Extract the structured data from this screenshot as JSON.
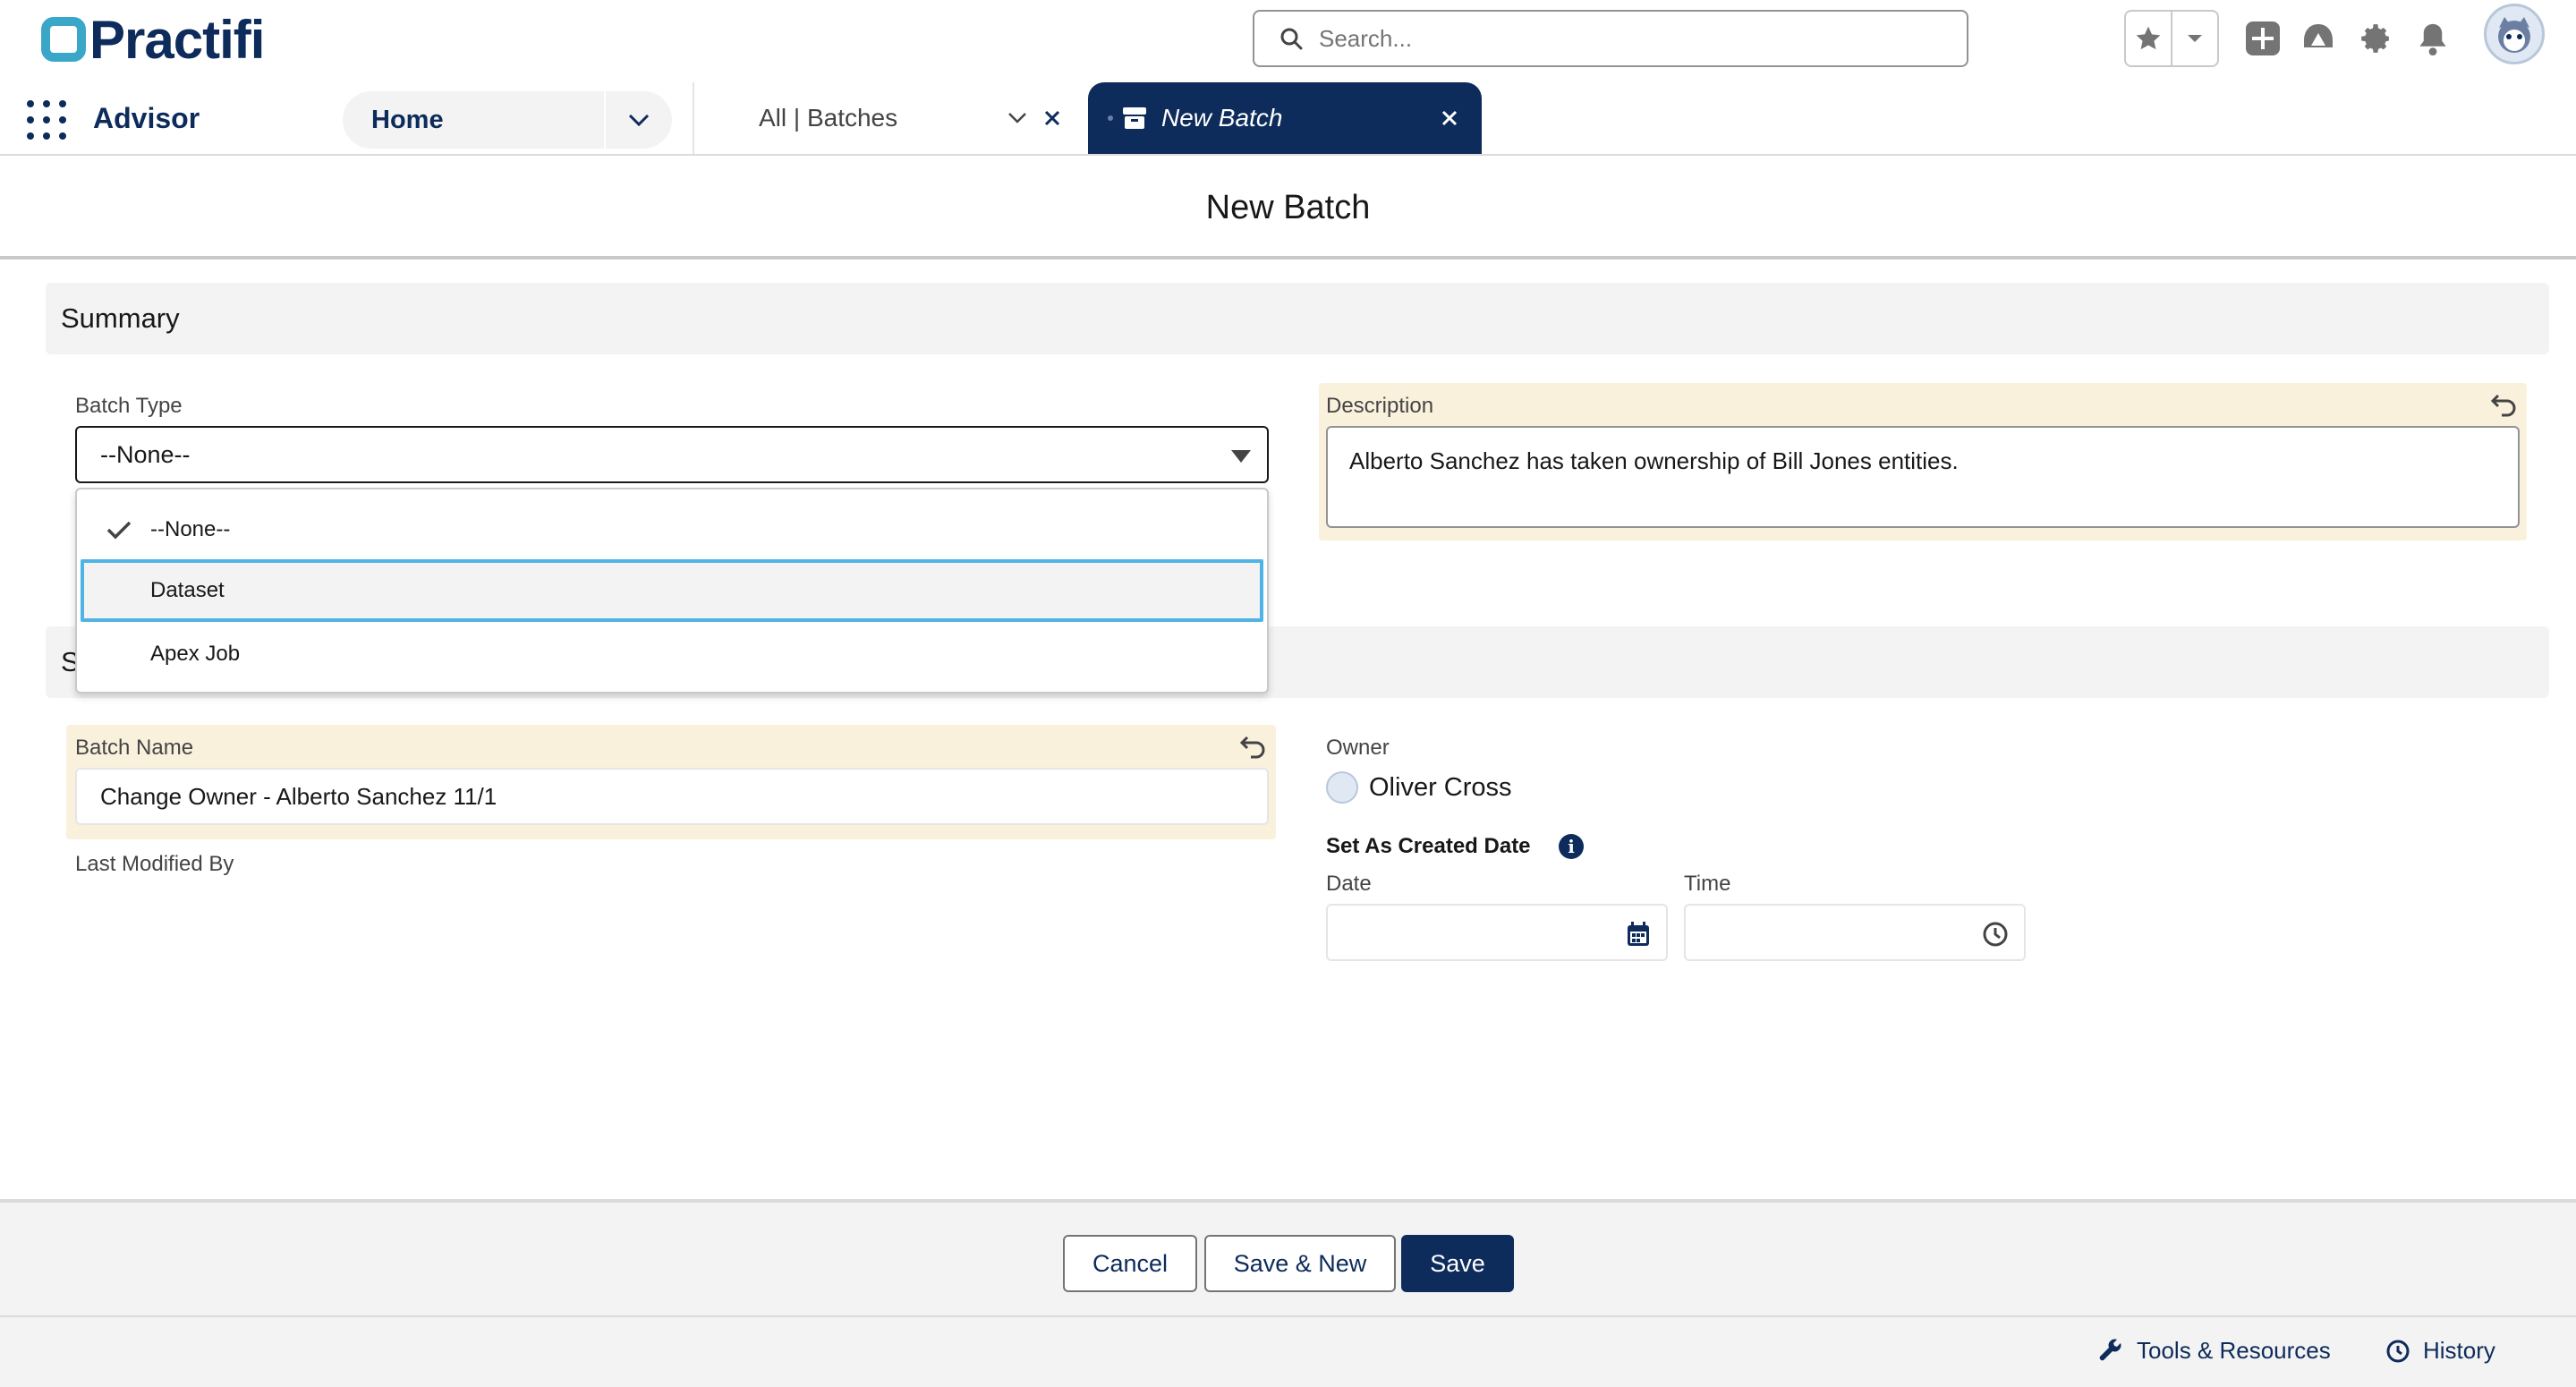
{
  "header": {
    "logo_text": "Practifi",
    "search_placeholder": "Search..."
  },
  "nav": {
    "app_name": "Advisor",
    "home_tab": "Home",
    "tabs": [
      {
        "label": "All | Batches"
      },
      {
        "label": "New Batch"
      }
    ]
  },
  "page": {
    "title": "New Batch"
  },
  "summary": {
    "section_title": "Summary",
    "batch_type": {
      "label": "Batch Type",
      "value": "--None--",
      "options": [
        "--None--",
        "Dataset",
        "Apex Job"
      ],
      "selected_option": "--None--",
      "focused_option": "Dataset"
    },
    "description": {
      "label": "Description",
      "value": "Alberto Sanchez has taken ownership of Bill Jones entities."
    }
  },
  "system": {
    "section_title_partial": "S",
    "batch_name": {
      "label": "Batch Name",
      "value": "Change Owner - Alberto Sanchez 11/1"
    },
    "last_modified_by": {
      "label": "Last Modified By"
    },
    "owner": {
      "label": "Owner",
      "name": "Oliver Cross"
    },
    "set_as_created_date": {
      "label": "Set As Created Date",
      "date_label": "Date",
      "time_label": "Time"
    }
  },
  "actions": {
    "cancel": "Cancel",
    "save_new": "Save & New",
    "save": "Save"
  },
  "utility": {
    "tools": "Tools & Resources",
    "history": "History"
  },
  "colors": {
    "brand": "#0d2b5b",
    "accent": "#3aa7c9",
    "highlight": "#faf1dd",
    "focus": "#4fb4e5"
  }
}
